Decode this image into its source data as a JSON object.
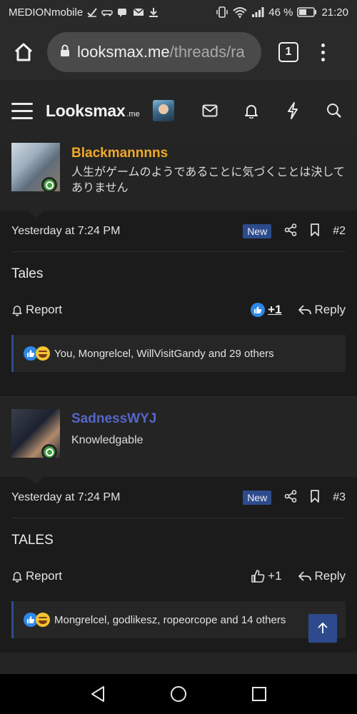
{
  "status_bar": {
    "carrier": "MEDIONmobile",
    "battery_text": "46 %",
    "time": "21:20"
  },
  "browser": {
    "url_domain": "looksmax.me",
    "url_path": "/threads/ra",
    "tab_count": "1"
  },
  "site": {
    "logo_main": "Looksmax",
    "logo_sub": ".me"
  },
  "posts": [
    {
      "username": "Blackmannnns",
      "username_color": "#f0a928",
      "user_title": "人生がゲームのようであることに気づくことは決してありません",
      "timestamp": "Yesterday at 7:24 PM",
      "badge": "New",
      "post_number": "#2",
      "body": "Tales",
      "report_label": "Report",
      "like_count": "+1",
      "reply_label": "Reply",
      "reactions_text": "You, Mongrelcel, WillVisitGandy and 29 others"
    },
    {
      "username": "SadnessWYJ",
      "username_color": "#5566c8",
      "user_title": "Knowledgable",
      "timestamp": "Yesterday at 7:24 PM",
      "badge": "New",
      "post_number": "#3",
      "body": "TALES",
      "report_label": "Report",
      "like_count": "+1",
      "reply_label": "Reply",
      "reactions_text": "Mongrelcel, godlikesz, ropeorcope and 14 others"
    }
  ],
  "colors": {
    "accent_blue": "#2d4b8c",
    "online_green": "#3f9b3f"
  }
}
